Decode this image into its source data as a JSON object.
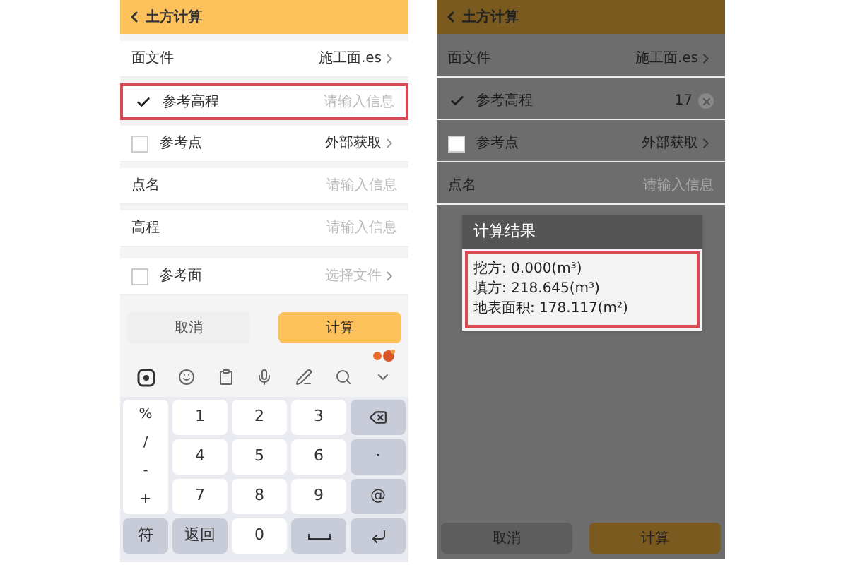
{
  "left_screen": {
    "title": "土方计算",
    "rows": [
      {
        "kind": "nav",
        "label": "面文件",
        "value": "施工面.es",
        "chevron": true,
        "highlighted": false
      },
      {
        "kind": "check",
        "label": "参考高程",
        "checked": true,
        "placeholder": "请输入信息",
        "chevron": false,
        "highlighted": true
      },
      {
        "kind": "check",
        "label": "参考点",
        "checked": false,
        "value": "外部获取",
        "chevron": true,
        "highlighted": false
      },
      {
        "kind": "input",
        "label": "点名",
        "placeholder": "请输入信息",
        "chevron": false,
        "highlighted": false
      },
      {
        "kind": "input",
        "label": "高程",
        "placeholder": "请输入信息",
        "chevron": false,
        "highlighted": false
      },
      {
        "kind": "check",
        "label": "参考面",
        "checked": false,
        "placeholder": "选择文件",
        "chevron": true,
        "highlighted": false
      }
    ],
    "buttons": [
      {
        "label": "取消",
        "kind": "secondary"
      },
      {
        "label": "计算",
        "kind": "primary"
      }
    ],
    "keyboard": {
      "symbols": [
        "%",
        "/",
        "-",
        "+"
      ],
      "rows": [
        [
          {
            "kind": "char",
            "label": "1"
          },
          {
            "kind": "char",
            "label": "2"
          },
          {
            "kind": "char",
            "label": "3"
          },
          {
            "kind": "backspace"
          }
        ],
        [
          {
            "kind": "char",
            "label": "4"
          },
          {
            "kind": "char",
            "label": "5"
          },
          {
            "kind": "char",
            "label": "6"
          },
          {
            "kind": "fn",
            "label": "·"
          }
        ],
        [
          {
            "kind": "char",
            "label": "7"
          },
          {
            "kind": "char",
            "label": "8"
          },
          {
            "kind": "char",
            "label": "9"
          },
          {
            "kind": "fn",
            "label": "@"
          }
        ]
      ],
      "bottom": [
        {
          "kind": "fn",
          "label": "符"
        },
        {
          "kind": "fn",
          "label": "返回"
        },
        {
          "kind": "char",
          "label": "0"
        },
        {
          "kind": "space"
        },
        {
          "kind": "enter"
        }
      ]
    }
  },
  "right_screen": {
    "title": "土方计算",
    "rows": [
      {
        "kind": "nav",
        "label": "面文件",
        "value": "施工面.es",
        "chevron": true,
        "clear": false
      },
      {
        "kind": "check",
        "label": "参考高程",
        "checked": true,
        "value": "17",
        "chevron": false,
        "clear": true
      },
      {
        "kind": "check",
        "label": "参考点",
        "checked": false,
        "value": "外部获取",
        "chevron": true,
        "clear": false
      },
      {
        "kind": "input",
        "label": "点名",
        "placeholder": "请输入信息",
        "chevron": false,
        "clear": false
      }
    ],
    "dialog": {
      "title": "计算结果",
      "lines": [
        "挖方: 0.000(m³)",
        "填方: 218.645(m³)",
        "地表面积: 178.117(m²)"
      ],
      "highlighted": true
    },
    "buttons": [
      {
        "label": "取消",
        "kind": "secondary"
      },
      {
        "label": "计算",
        "kind": "primary"
      }
    ]
  }
}
